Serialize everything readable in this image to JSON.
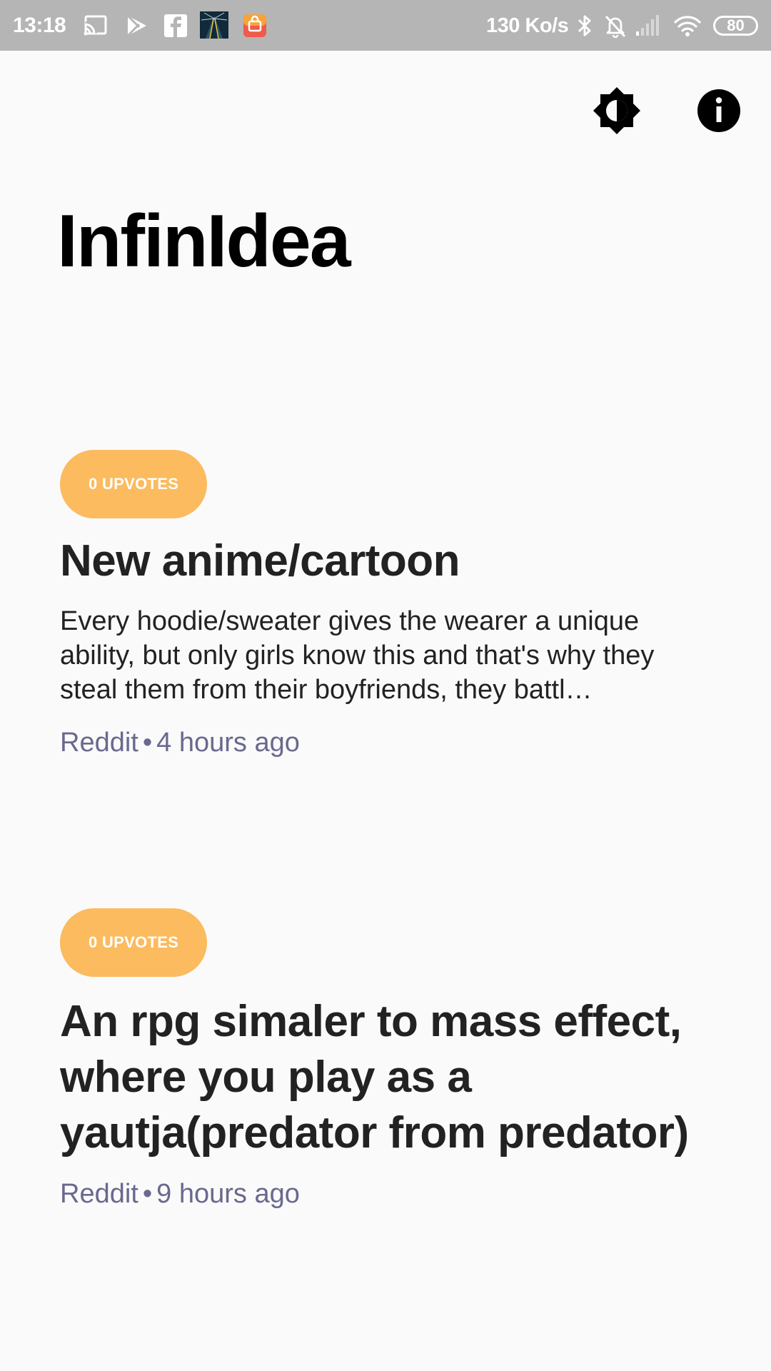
{
  "status_bar": {
    "time": "13:18",
    "network_speed": "130 Ko/s",
    "battery_level": "80",
    "icons": [
      "cast-icon",
      "play-store-icon",
      "facebook-icon",
      "wallpaper-thumbnail-icon",
      "shop-app-icon",
      "bluetooth-icon",
      "bell-muted-icon",
      "signal-icon",
      "wifi-icon",
      "battery-icon"
    ]
  },
  "app_bar": {
    "actions": [
      "theme-toggle-icon",
      "info-icon"
    ]
  },
  "app": {
    "title": "InfinIdea"
  },
  "colors": {
    "background": "#FAFAFA",
    "badge": "#FBBB5E",
    "meta_text": "#69698F",
    "status_bar": "#B5B5B5"
  },
  "ideas": [
    {
      "upvotes": "0 UPVOTES",
      "title": "New anime/cartoon",
      "description": "Every hoodie/sweater gives the wearer a unique ability, but only girls know this and that's why they steal them from their boyfriends, they battl…",
      "source": "Reddit",
      "time_ago": "4 hours ago"
    },
    {
      "upvotes": "0 UPVOTES",
      "title": "An rpg simaler to mass effect, where you play as a yautja(predator from predator)",
      "description": "",
      "source": "Reddit",
      "time_ago": "9 hours ago"
    }
  ]
}
